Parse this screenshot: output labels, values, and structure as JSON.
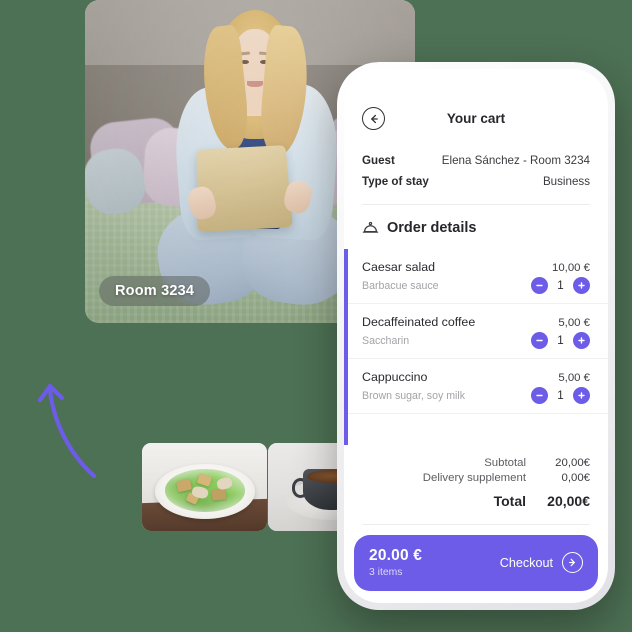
{
  "theme": {
    "background": "#4d7154",
    "accent": "#6c5ce7",
    "card": "#ffffff"
  },
  "hero": {
    "alt": "Hotel guest sitting on bed using a tablet",
    "room_badge": "Room 3234"
  },
  "thumbnails": [
    {
      "name": "caesar-salad-photo",
      "alt": "Caesar salad on a white plate"
    },
    {
      "name": "coffee-photo",
      "alt": "Espresso in a dark cup"
    }
  ],
  "phone": {
    "header": {
      "back_icon": "arrow-left-circle-icon",
      "title": "Your cart"
    },
    "guest_info": [
      {
        "label": "Guest",
        "value": "Elena Sánchez - Room 3234"
      },
      {
        "label": "Type of stay",
        "value": "Business"
      }
    ],
    "order_section": {
      "icon": "room-service-cloche-icon",
      "title": "Order details"
    },
    "items": [
      {
        "name": "Caesar salad",
        "note": "Barbacue sauce",
        "price": "10,00 €",
        "qty": "1",
        "minus_icon": "minus-icon",
        "plus_icon": "plus-icon"
      },
      {
        "name": "Decaffeinated coffee",
        "note": "Saccharin",
        "price": "5,00 €",
        "qty": "1",
        "minus_icon": "minus-icon",
        "plus_icon": "plus-icon"
      },
      {
        "name": "Cappuccino",
        "note": "Brown sugar, soy milk",
        "price": "5,00 €",
        "qty": "1",
        "minus_icon": "minus-icon",
        "plus_icon": "plus-icon"
      }
    ],
    "totals": [
      {
        "label": "Subtotal",
        "value": "20,00€"
      },
      {
        "label": "Delivery supplement",
        "value": "0,00€"
      }
    ],
    "grand_total": {
      "label": "Total",
      "value": "20,00€"
    },
    "checkout": {
      "amount": "20.00 €",
      "items_count": "3 items",
      "label": "Checkout",
      "arrow_icon": "arrow-right-circle-icon"
    }
  }
}
